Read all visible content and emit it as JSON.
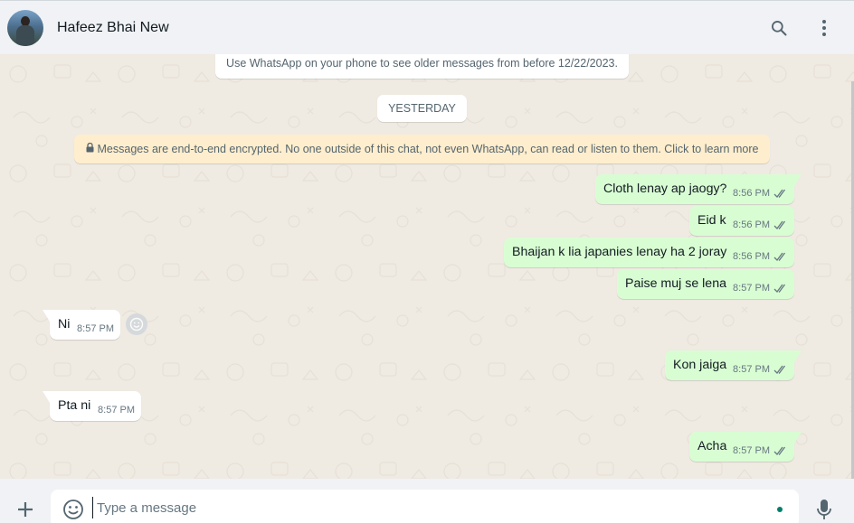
{
  "header": {
    "contact_name": "Hafeez Bhai New",
    "icons": [
      "search-icon",
      "menu-icon"
    ]
  },
  "chat": {
    "older_note": "Use WhatsApp on your phone to see older messages from before 12/22/2023.",
    "date_label": "YESTERDAY",
    "encryption_note": "Messages are end-to-end encrypted. No one outside of this chat, not even WhatsApp, can read or listen to them. Click to learn more",
    "messages": [
      {
        "direction": "out",
        "text": "Cloth lenay ap jaogy?",
        "time": "8:56 PM",
        "status": "read-ticks"
      },
      {
        "direction": "out",
        "text": "Eid k",
        "time": "8:56 PM",
        "status": "read-ticks"
      },
      {
        "direction": "out",
        "text": "Bhaijan k lia japanies lenay ha 2 joray",
        "time": "8:56 PM",
        "status": "read-ticks"
      },
      {
        "direction": "out",
        "text": "Paise muj se lena",
        "time": "8:57 PM",
        "status": "read-ticks"
      },
      {
        "direction": "in",
        "text": "Ni",
        "time": "8:57 PM"
      },
      {
        "direction": "out",
        "text": "Kon jaiga",
        "time": "8:57 PM",
        "status": "read-ticks"
      },
      {
        "direction": "in",
        "text": "Pta ni",
        "time": "8:57 PM"
      },
      {
        "direction": "out",
        "text": "Acha",
        "time": "8:57 PM",
        "status": "read-ticks"
      }
    ]
  },
  "composer": {
    "placeholder": "Type a message",
    "icons": [
      "plus-icon",
      "emoji-icon",
      "mic-icon"
    ]
  },
  "colors": {
    "outgoing_bubble": "#d9fdd3",
    "incoming_bubble": "#ffffff",
    "chat_background": "#efeae2",
    "encryption_banner": "#ffeecd",
    "tick_color": "#667781",
    "accent": "#008069"
  }
}
